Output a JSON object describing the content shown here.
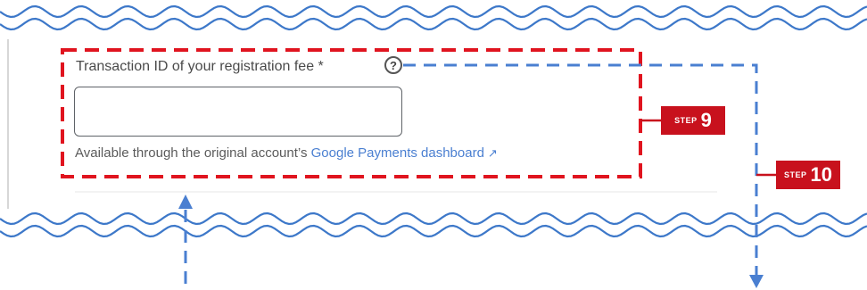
{
  "form": {
    "field_label": "Transaction ID of your registration fee *",
    "help_icon_glyph": "?",
    "input_value": "",
    "helper_prefix": "Available through the original account’s ",
    "helper_link": "Google Payments dashboard",
    "external_link_glyph": "↗"
  },
  "annotations": {
    "step9": {
      "prefix": "STEP",
      "number": "9"
    },
    "step10": {
      "prefix": "STEP",
      "number": "10"
    }
  },
  "icons": {
    "help": "question-circle-icon",
    "external": "external-link-icon"
  },
  "colors": {
    "highlight_box": "#e0141f",
    "badge": "#c8111d",
    "arrows": "#4a7fd1",
    "wave": "#3d78c9",
    "link": "#4a7fd1"
  }
}
